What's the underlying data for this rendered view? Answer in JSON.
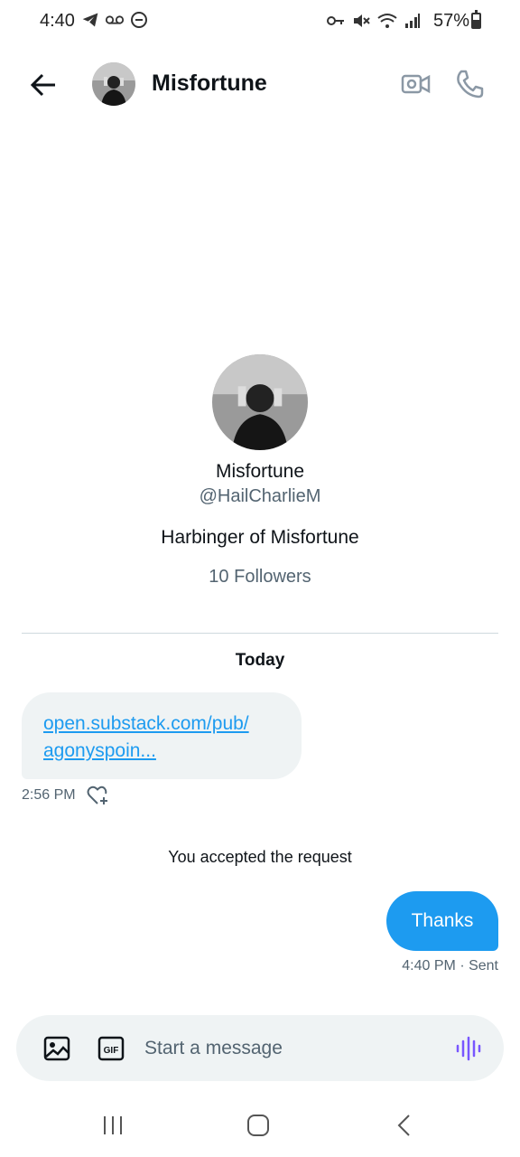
{
  "status_bar": {
    "time": "4:40",
    "battery_text": "57%",
    "icons": [
      "telegram-icon",
      "voicemail-icon",
      "dnd-icon",
      "key-icon",
      "mute-icon",
      "wifi-icon",
      "signal-icon",
      "battery-icon"
    ]
  },
  "header": {
    "name": "Misfortune",
    "icons": [
      "back-arrow-icon",
      "video-call-icon",
      "phone-icon"
    ]
  },
  "profile": {
    "name": "Misfortune",
    "handle": "@HailCharlieM",
    "bio": "Harbinger of Misfortune",
    "followers": "10 Followers"
  },
  "conversation": {
    "date_label": "Today",
    "incoming": {
      "link_line1": "open.substack.com/pub/",
      "link_line2": "agonyspoin...",
      "time": "2:56 PM"
    },
    "system_message": "You accepted the request",
    "outgoing": {
      "text": "Thanks",
      "meta": "4:40 PM · Sent"
    }
  },
  "composer": {
    "placeholder": "Start a message",
    "icons": [
      "image-icon",
      "gif-icon",
      "voice-icon"
    ]
  },
  "colors": {
    "accent": "#1d9bf0",
    "bubble_incoming": "#eff3f4",
    "secondary_text": "#536471",
    "voice_icon": "#7856ff"
  }
}
